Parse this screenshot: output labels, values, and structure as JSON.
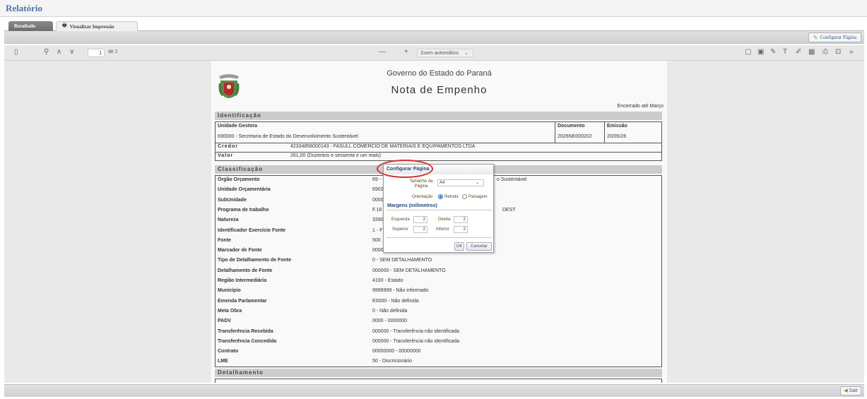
{
  "app": {
    "title": "Relatório"
  },
  "tabs": [
    {
      "label": "Resultado"
    },
    {
      "label": "Visualizar Impressão"
    }
  ],
  "actionbar": {
    "configure_label": "Configurar Página"
  },
  "viewer_toolbar": {
    "page_value": "1",
    "page_of": "de 1",
    "zoom_minus": "—",
    "zoom_plus": "+",
    "zoom_value": "Zoom automático"
  },
  "document": {
    "gov_title": "Governo do Estado do Paraná",
    "doc_title": "Nota de Empenho",
    "encerrado": "Encerrado até Março",
    "identificacao": {
      "header": "Identificação",
      "unidade_label": "Unidade Gestora",
      "unidade_value": "690000 - Secretaria de Estado do Desenvolvimento Sustentável",
      "documento_label": "Documento",
      "documento_value": "2026NE000202",
      "emissao_label": "Emissão",
      "emissao_value": "20/05/26",
      "credor_label": "Credor",
      "credor_value": "42334856000143 - FASULL COMERCIO DE MATERIAIS E EQUIPAMENTOS LTDA",
      "valor_label": "Valor",
      "valor_value": "261,00 (Duzentos e sessenta e um reais)"
    },
    "classificacao": {
      "header": "Classificação",
      "rows": [
        {
          "label": "Órgão Orçamento",
          "value": "69 -",
          "extra": "o Sustentável"
        },
        {
          "label": "Unidade Orçamentária",
          "value": "6902"
        },
        {
          "label": "SubUnidade",
          "value": "0000"
        },
        {
          "label": "Programa de trabalho",
          "value": "F.18",
          "extra": "DEST"
        },
        {
          "label": "Natureza",
          "value": "3390"
        },
        {
          "label": "Identificador Exercício Fonte",
          "value": "1 - F"
        },
        {
          "label": "Fonte",
          "value": "500"
        },
        {
          "label": "Marcador de Fonte",
          "value": "0000"
        },
        {
          "label": "Tipo de Detalhamento de Fonte",
          "value": "0 - SEM DETALHAMENTO"
        },
        {
          "label": "Detalhamento de Fonte",
          "value": "000000 - SEM DETALHAMENTO"
        },
        {
          "label": "Região Intermediária",
          "value": "4100 - Estado"
        },
        {
          "label": "Município",
          "value": "9999999 - Não informado"
        },
        {
          "label": "Emenda Parlamentar",
          "value": "E0000 - Não definida"
        },
        {
          "label": "Meta Obra",
          "value": "0 - Não definida"
        },
        {
          "label": "PADV",
          "value": "0000 - 0000000"
        },
        {
          "label": "Transferência Recebida",
          "value": "000000 - Transferência não identificada"
        },
        {
          "label": "Transferência Concedida",
          "value": "000000 - Transferência não identificada"
        },
        {
          "label": "Contrato",
          "value": "00000000 - 00000000"
        },
        {
          "label": "LME",
          "value": "50 - Discricionário"
        }
      ]
    },
    "detalhamento": {
      "header": "Detalhamento"
    }
  },
  "dialog": {
    "title": "Configurar Página",
    "tamanho_label": "Tamanho da Página",
    "tamanho_value": "A4",
    "orientacao_label": "Orientação",
    "retrato_label": "Retrato",
    "paisagem_label": "Paisagem",
    "margens_label": "Margens (milimetros)",
    "esquerda_label": "Esquerda",
    "esquerda_value": "2",
    "direita_label": "Direita",
    "direita_value": "2",
    "superior_label": "Superior",
    "superior_value": "2",
    "inferior_label": "Inferior",
    "inferior_value": "2",
    "ok_label": "OK",
    "cancel_label": "Cancelar"
  },
  "bottombar": {
    "sair_label": "Sair"
  },
  "colors": {
    "accent": "#4d74a8",
    "highlight": "#d42f2f",
    "section_bg": "#cccccc"
  }
}
